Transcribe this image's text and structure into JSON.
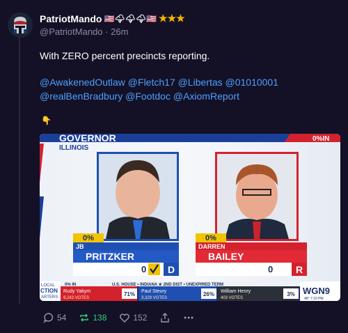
{
  "post": {
    "display_name": "PatriotMando",
    "name_emojis": "🇺🇸🌩🌩🌩🇺🇸",
    "name_stars": "★★★",
    "handle": "@PatriotMando",
    "separator": "·",
    "time": "26m",
    "text": "With ZERO percent precincts reporting.",
    "mentions_line1": "@AwakenedOutlaw @Fletch17 @Libertas @01010001",
    "mentions_line2": "@realBenBradbury @Footdoc @AxiomReport",
    "point_emoji": "👇"
  },
  "media": {
    "title": "GOVERNOR",
    "subtitle": "ILLINOIS",
    "pct_in": "0%IN",
    "left_candidate": {
      "pct": "0%",
      "first": "JB",
      "last": "PRITZKER",
      "votes": "0",
      "party": "D"
    },
    "right_candidate": {
      "pct": "0%",
      "first": "DARREN",
      "last": "BAILEY",
      "votes": "0",
      "party": "R"
    },
    "ticker_label": "U.S. HOUSE • INDIANA ★ 2ND DIST • UNEXPIRED TERM",
    "ticker_local": "LOCAL",
    "ticker_side": "CTION",
    "ticker_side2": "ARTERS",
    "ticker_pct": "0% IN",
    "ticker_c1_name": "Rudy Yakym",
    "ticker_c1_votes": "9,243 VOTES",
    "ticker_c1_pct": "71%",
    "ticker_c2_name": "Paul Steury",
    "ticker_c2_votes": "3,329 VOTES",
    "ticker_c2_pct": "26%",
    "ticker_c3_name": "William Henry",
    "ticker_c3_votes": "403 VOTES",
    "ticker_c3_pct": "3%",
    "station": "WGN9",
    "weather": "48°  7:10 PM",
    "colors": {
      "dem": "#1f4fb0",
      "rep": "#d3222e",
      "gold": "#f2c300"
    }
  },
  "actions": {
    "replies": "54",
    "reposts": "138",
    "likes": "152"
  }
}
